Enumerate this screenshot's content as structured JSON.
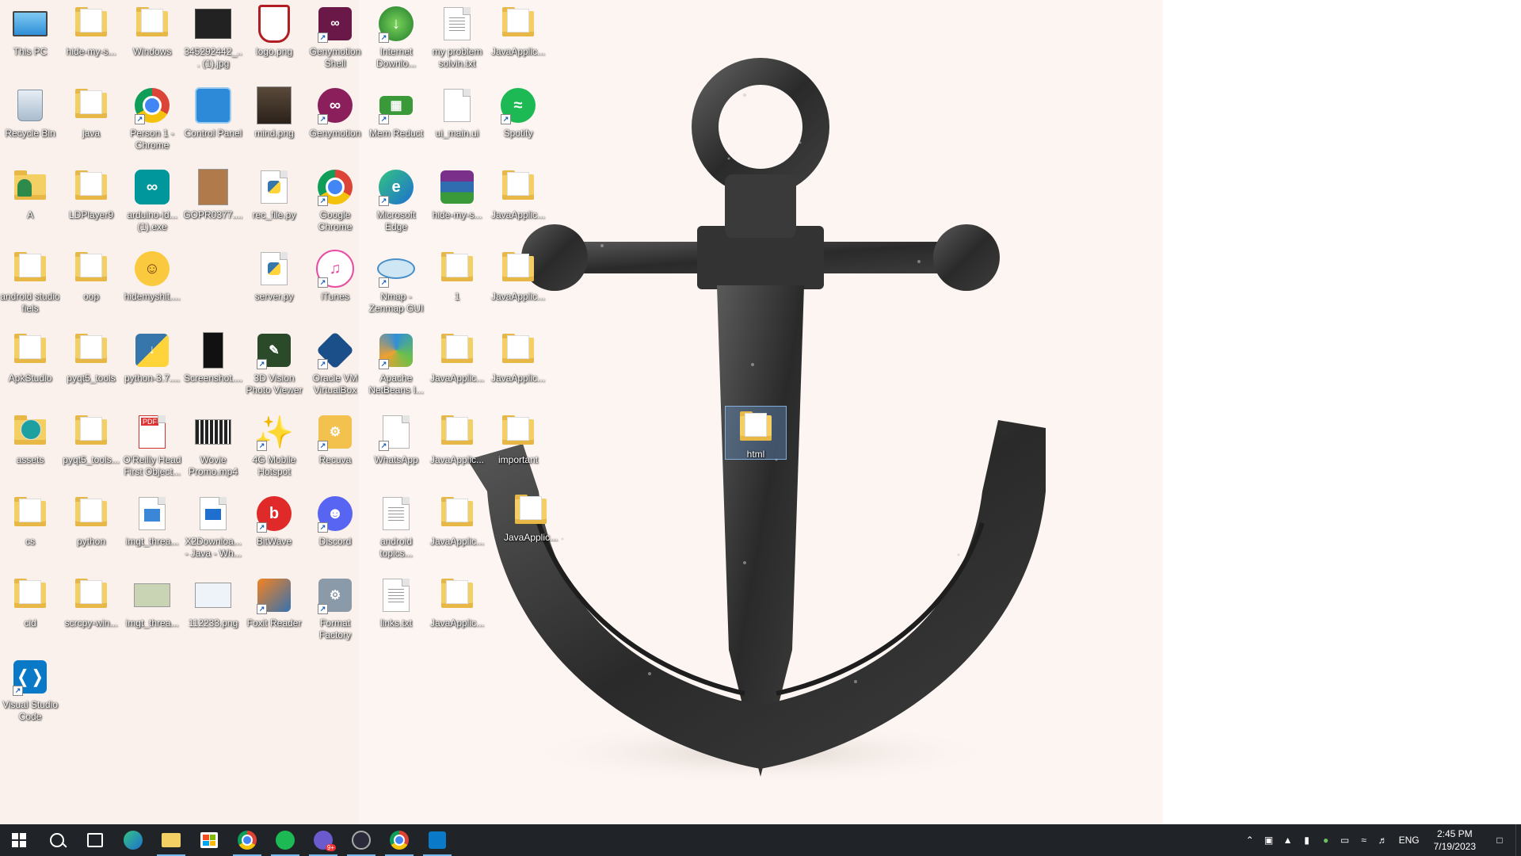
{
  "desktop": {
    "icons": [
      {
        "label": "This PC",
        "kind": "pc",
        "col": 0,
        "row": 0
      },
      {
        "label": "hide-my-s...",
        "kind": "folder",
        "col": 1,
        "row": 0
      },
      {
        "label": "Windows",
        "kind": "folder",
        "col": 2,
        "row": 0
      },
      {
        "label": "345292442_... (1).jpg",
        "kind": "image-dark",
        "col": 3,
        "row": 0
      },
      {
        "label": "logo.png",
        "kind": "logo",
        "col": 4,
        "row": 0
      },
      {
        "label": "Genymotion Shell",
        "kind": "genymotion-shell",
        "col": 5,
        "row": 0,
        "shortcut": true
      },
      {
        "label": "Internet Downlo...",
        "kind": "idm",
        "col": 6,
        "row": 0,
        "shortcut": true
      },
      {
        "label": "my problem solvin.txt",
        "kind": "text",
        "col": 7,
        "row": 0
      },
      {
        "label": "JavaApplic...",
        "kind": "folder",
        "col": 8,
        "row": 0
      },
      {
        "label": "Recycle Bin",
        "kind": "recycle",
        "col": 0,
        "row": 1
      },
      {
        "label": "java",
        "kind": "folder",
        "col": 1,
        "row": 1
      },
      {
        "label": "Person 1 - Chrome",
        "kind": "chrome-person",
        "col": 2,
        "row": 1,
        "shortcut": true
      },
      {
        "label": "Control Panel",
        "kind": "control-panel",
        "col": 3,
        "row": 1
      },
      {
        "label": "mind.png",
        "kind": "photo",
        "col": 4,
        "row": 1
      },
      {
        "label": "Genymotion",
        "kind": "genymotion",
        "col": 5,
        "row": 1,
        "shortcut": true
      },
      {
        "label": "Mem Reduct",
        "kind": "mem-reduct",
        "col": 6,
        "row": 1,
        "shortcut": true
      },
      {
        "label": "ui_main.ui",
        "kind": "blank",
        "col": 7,
        "row": 1
      },
      {
        "label": "Spotify",
        "kind": "spotify",
        "col": 8,
        "row": 1,
        "shortcut": true
      },
      {
        "label": "A",
        "kind": "user-folder",
        "col": 0,
        "row": 2
      },
      {
        "label": "LDPlayer9",
        "kind": "folder",
        "col": 1,
        "row": 2
      },
      {
        "label": "arduino-id... (1).exe",
        "kind": "arduino",
        "col": 2,
        "row": 2
      },
      {
        "label": "GOPR0377....",
        "kind": "image-brown",
        "col": 3,
        "row": 2
      },
      {
        "label": "rec_file.py",
        "kind": "python-file",
        "col": 4,
        "row": 2
      },
      {
        "label": "Google Chrome",
        "kind": "chrome",
        "col": 5,
        "row": 2,
        "shortcut": true
      },
      {
        "label": "Microsoft Edge",
        "kind": "edge",
        "col": 6,
        "row": 2,
        "shortcut": true
      },
      {
        "label": "hide-my-s...",
        "kind": "winrar",
        "col": 7,
        "row": 2
      },
      {
        "label": "JavaApplic...",
        "kind": "folder",
        "col": 8,
        "row": 2
      },
      {
        "label": "android studio fiels",
        "kind": "folder",
        "col": 0,
        "row": 3
      },
      {
        "label": "oop",
        "kind": "folder",
        "col": 1,
        "row": 3
      },
      {
        "label": "hidemyshit....",
        "kind": "emoji",
        "col": 2,
        "row": 3
      },
      {
        "label": "server.py",
        "kind": "python-file",
        "col": 4,
        "row": 3
      },
      {
        "label": "iTunes",
        "kind": "itunes",
        "col": 5,
        "row": 3,
        "shortcut": true
      },
      {
        "label": "Nmap - Zenmap GUI",
        "kind": "nmap",
        "col": 6,
        "row": 3,
        "shortcut": true
      },
      {
        "label": "1",
        "kind": "folder",
        "col": 7,
        "row": 3
      },
      {
        "label": "JavaApplic...",
        "kind": "folder",
        "col": 8,
        "row": 3
      },
      {
        "label": "ApkStudio",
        "kind": "folder",
        "col": 0,
        "row": 4
      },
      {
        "label": "pyqt5_tools",
        "kind": "folder",
        "col": 1,
        "row": 4
      },
      {
        "label": "python-3.7....",
        "kind": "python-installer",
        "col": 2,
        "row": 4
      },
      {
        "label": "Screenshot....",
        "kind": "image-phone",
        "col": 3,
        "row": 4
      },
      {
        "label": "3D Vision Photo Viewer",
        "kind": "3d-vision",
        "col": 4,
        "row": 4,
        "shortcut": true
      },
      {
        "label": "Oracle VM VirtualBox",
        "kind": "virtualbox",
        "col": 5,
        "row": 4,
        "shortcut": true
      },
      {
        "label": "Apache NetBeans I...",
        "kind": "netbeans",
        "col": 6,
        "row": 4,
        "shortcut": true
      },
      {
        "label": "JavaApplic...",
        "kind": "folder",
        "col": 7,
        "row": 4
      },
      {
        "label": "JavaApplic...",
        "kind": "folder",
        "col": 8,
        "row": 4
      },
      {
        "label": "assets",
        "kind": "edge-folder",
        "col": 0,
        "row": 5
      },
      {
        "label": "pyqt5_tools...",
        "kind": "folder",
        "col": 1,
        "row": 5
      },
      {
        "label": "O'Reilly Head First Object...",
        "kind": "pdf",
        "col": 2,
        "row": 5
      },
      {
        "label": "Wovie Promo.mp4",
        "kind": "video",
        "col": 3,
        "row": 5
      },
      {
        "label": "4G Mobile Hotspot",
        "kind": "hotspot",
        "col": 4,
        "row": 5,
        "shortcut": true
      },
      {
        "label": "Recuva",
        "kind": "recuva",
        "col": 5,
        "row": 5,
        "shortcut": true
      },
      {
        "label": "WhatsApp",
        "kind": "blank",
        "col": 6,
        "row": 5,
        "shortcut": true
      },
      {
        "label": "JavaApplic...",
        "kind": "folder",
        "col": 7,
        "row": 5
      },
      {
        "label": "important",
        "kind": "folder",
        "col": 8,
        "row": 5
      },
      {
        "label": "cs",
        "kind": "folder",
        "col": 0,
        "row": 6
      },
      {
        "label": "python",
        "kind": "folder",
        "col": 1,
        "row": 6
      },
      {
        "label": "imgt_threa...",
        "kind": "image-file",
        "col": 2,
        "row": 6
      },
      {
        "label": "X2Downloa... - Java - Wh...",
        "kind": "video-file",
        "col": 3,
        "row": 6
      },
      {
        "label": "BitWave",
        "kind": "bitwave",
        "col": 4,
        "row": 6,
        "shortcut": true
      },
      {
        "label": "Discord",
        "kind": "discord",
        "col": 5,
        "row": 6,
        "shortcut": true
      },
      {
        "label": "android topics...",
        "kind": "text",
        "col": 6,
        "row": 6
      },
      {
        "label": "JavaApplic...",
        "kind": "folder",
        "col": 7,
        "row": 6
      },
      {
        "label": "cid",
        "kind": "folder",
        "col": 0,
        "row": 7
      },
      {
        "label": "scrcpy-win...",
        "kind": "folder",
        "col": 1,
        "row": 7
      },
      {
        "label": "imgt_threa...",
        "kind": "image-green",
        "col": 2,
        "row": 7
      },
      {
        "label": "112233.png",
        "kind": "image-light",
        "col": 3,
        "row": 7
      },
      {
        "label": "Foxit Reader",
        "kind": "foxit",
        "col": 4,
        "row": 7,
        "shortcut": true
      },
      {
        "label": "Format Factory",
        "kind": "format-factory",
        "col": 5,
        "row": 7,
        "shortcut": true
      },
      {
        "label": "links.txt",
        "kind": "text",
        "col": 6,
        "row": 7
      },
      {
        "label": "JavaApplic...",
        "kind": "folder",
        "col": 7,
        "row": 7
      },
      {
        "label": "Visual Studio Code",
        "kind": "vscode",
        "col": 0,
        "row": 8,
        "shortcut": true
      }
    ],
    "floating_icons": [
      {
        "label": "html",
        "kind": "folder",
        "selected": true
      },
      {
        "label": "JavaApplic...",
        "kind": "folder",
        "selected": false
      }
    ]
  },
  "taskbar": {
    "apps": [
      {
        "name": "start",
        "kind": "windows"
      },
      {
        "name": "search",
        "kind": "search"
      },
      {
        "name": "task-view",
        "kind": "taskview"
      },
      {
        "name": "edge",
        "kind": "edge"
      },
      {
        "name": "file-explorer",
        "kind": "explorer",
        "active": true
      },
      {
        "name": "store",
        "kind": "store"
      },
      {
        "name": "chrome",
        "kind": "chrome",
        "active": true
      },
      {
        "name": "spotify",
        "kind": "spotify",
        "active": true
      },
      {
        "name": "chrome-profile",
        "kind": "chrome-profile",
        "active": true
      },
      {
        "name": "obs",
        "kind": "obs",
        "active": true
      },
      {
        "name": "chrome-2",
        "kind": "chrome",
        "active": true
      },
      {
        "name": "vscode",
        "kind": "vscode",
        "active": true
      }
    ],
    "tray": {
      "language": "ENG",
      "time": "2:45 PM",
      "date": "7/19/2023"
    }
  },
  "colors": {
    "taskbar_bg": "#202327",
    "folder": "#f4cf63",
    "accent": "#76b9ed"
  }
}
